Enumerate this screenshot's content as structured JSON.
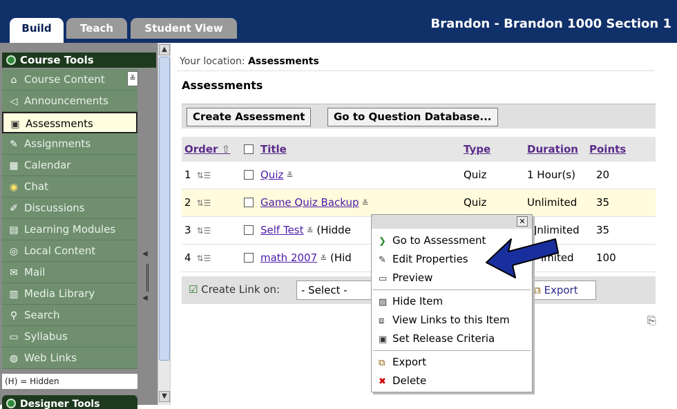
{
  "tabs": {
    "build": "Build",
    "teach": "Teach",
    "student_view": "Student View"
  },
  "course_title": "Brandon - Brandon 1000 Section 1",
  "left": {
    "header": "Course Tools",
    "items": [
      {
        "icon": "home-icon",
        "label": "Course Content"
      },
      {
        "icon": "megaphone-icon",
        "label": "Announcements"
      },
      {
        "icon": "assessment-icon",
        "label": "Assessments"
      },
      {
        "icon": "assignment-icon",
        "label": "Assignments"
      },
      {
        "icon": "calendar-icon",
        "label": "Calendar"
      },
      {
        "icon": "chat-icon",
        "label": "Chat"
      },
      {
        "icon": "discussion-icon",
        "label": "Discussions"
      },
      {
        "icon": "module-icon",
        "label": "Learning Modules"
      },
      {
        "icon": "disc-icon",
        "label": "Local Content"
      },
      {
        "icon": "mail-icon",
        "label": "Mail"
      },
      {
        "icon": "media-icon",
        "label": "Media Library"
      },
      {
        "icon": "search-icon",
        "label": "Search"
      },
      {
        "icon": "syllabus-icon",
        "label": "Syllabus"
      },
      {
        "icon": "globe-icon",
        "label": "Web Links"
      }
    ],
    "hidden_note": "(H) = Hidden",
    "designer_tools": "Designer Tools"
  },
  "main": {
    "location_prefix": "Your location:",
    "location": "Assessments",
    "title": "Assessments",
    "buttons": {
      "create": "Create Assessment",
      "question_db": "Go to Question Database..."
    },
    "columns": {
      "order": "Order",
      "title": "Title",
      "type": "Type",
      "duration": "Duration",
      "points": "Points"
    },
    "rows": [
      {
        "order": "1",
        "title": "Quiz",
        "suffix": "",
        "type": "Quiz",
        "duration": "1 Hour(s)",
        "points": "20"
      },
      {
        "order": "2",
        "title": "Game Quiz Backup",
        "suffix": "",
        "type": "Quiz",
        "duration": "Unlimited",
        "points": "35"
      },
      {
        "order": "3",
        "title": "Self Test",
        "suffix": "(Hidde",
        "type": "",
        "duration": "Jnlimited",
        "points": "35"
      },
      {
        "order": "4",
        "title": "math 2007",
        "suffix": "(Hid",
        "type": "",
        "duration": "imited",
        "points": "100"
      }
    ],
    "create_link_label": "Create Link on:",
    "select_value": "- Select -",
    "export_label": "Export"
  },
  "context_menu": {
    "items": [
      {
        "icon": "chevron-right-icon",
        "label": "Go to Assessment"
      },
      {
        "icon": "pencil-icon",
        "label": "Edit Properties"
      },
      {
        "icon": "preview-icon",
        "label": "Preview"
      },
      {
        "icon": "hide-icon",
        "label": "Hide Item"
      },
      {
        "icon": "links-icon",
        "label": "View Links to this Item"
      },
      {
        "icon": "release-icon",
        "label": "Set Release Criteria"
      },
      {
        "icon": "export-icon",
        "label": "Export"
      },
      {
        "icon": "delete-icon",
        "label": "Delete"
      }
    ]
  },
  "colors": {
    "topbar": "#10306a",
    "menu_green": "#6f8f6f",
    "header_green": "#1e3a1e",
    "arrow_blue": "#1a2f9e"
  }
}
